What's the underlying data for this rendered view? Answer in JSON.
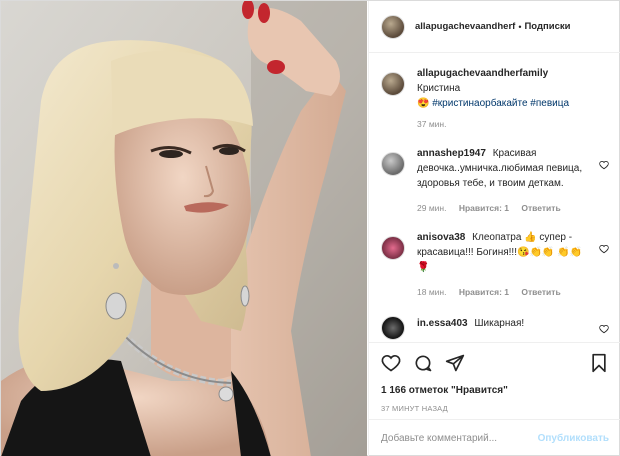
{
  "post": {
    "author": "allapugachevaandherf",
    "dot": "•",
    "follow_label": "Подписки"
  },
  "caption": {
    "user": "allapugachevaandherfamily",
    "text": "Кристина",
    "emoji": "😍",
    "hashtags": "#кристинаорбакайте #певица",
    "time": "37 мин."
  },
  "comments": [
    {
      "user": "annashep1947",
      "text": "Красивая девочка..умничка.любимая певица, здоровья тебе, и твоим деткам.",
      "time": "29 мин.",
      "likes": "Нравится: 1",
      "reply": "Ответить"
    },
    {
      "user": "anisova38",
      "text": "Клеопатра 👍 супер - красавица!!! Богиня!!!😘👏👏 👏👏🌹",
      "time": "18 мин.",
      "likes": "Нравится: 1",
      "reply": "Ответить"
    },
    {
      "user": "in.essa403",
      "text": "Шикарная!"
    }
  ],
  "actions": {
    "likes": "1 166 отметок \"Нравится\"",
    "time": "37 МИНУТ НАЗАД"
  },
  "comment_box": {
    "placeholder": "Добавьте комментарий...",
    "publish": "Опубликовать"
  },
  "colors": {
    "link": "#00376b",
    "muted": "#8e8e8e",
    "publish_disabled": "#b2dffc"
  }
}
